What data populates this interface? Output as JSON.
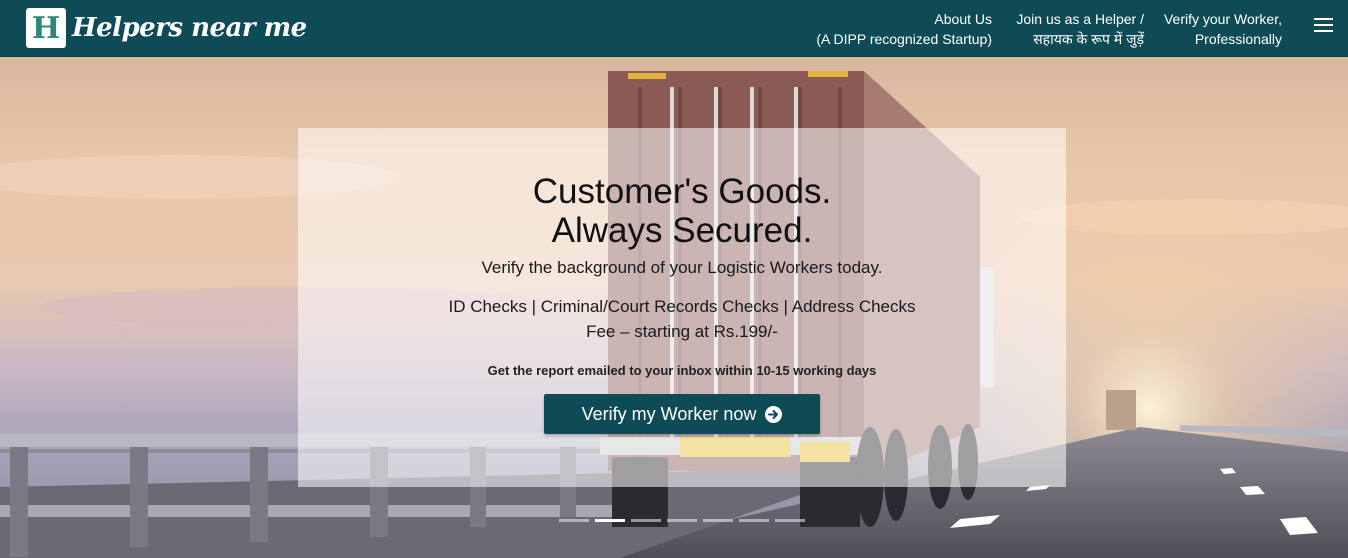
{
  "navbar": {
    "logo_mark": "H",
    "logo_text": "Helpers near me",
    "links": [
      {
        "line1": "About Us",
        "line2": "(A DIPP recognized Startup)"
      },
      {
        "line1": "Join us as a Helper /",
        "line2": "सहायक के रूप में जुड़ें"
      },
      {
        "line1": "Verify your Worker,",
        "line2": "Professionally"
      }
    ],
    "menu_icon": "hamburger-menu-icon"
  },
  "hero": {
    "headline_line1": "Customer's Goods.",
    "headline_line2": "Always Secured.",
    "tagline": "Verify the background of your Logistic Workers today.",
    "checks": "ID Checks | Criminal/Court Records Checks | Address Checks",
    "fee": "Fee – starting at Rs.199/-",
    "report_note": "Get the report emailed to your inbox within 10-15 working days",
    "cta_label": "Verify my Worker now",
    "cta_icon": "arrow-circle-right-icon"
  },
  "carousel": {
    "slide_count": 7,
    "active_slide": 2
  },
  "colors": {
    "brand": "#0f4b57",
    "logo_accent": "#2a8a78"
  }
}
